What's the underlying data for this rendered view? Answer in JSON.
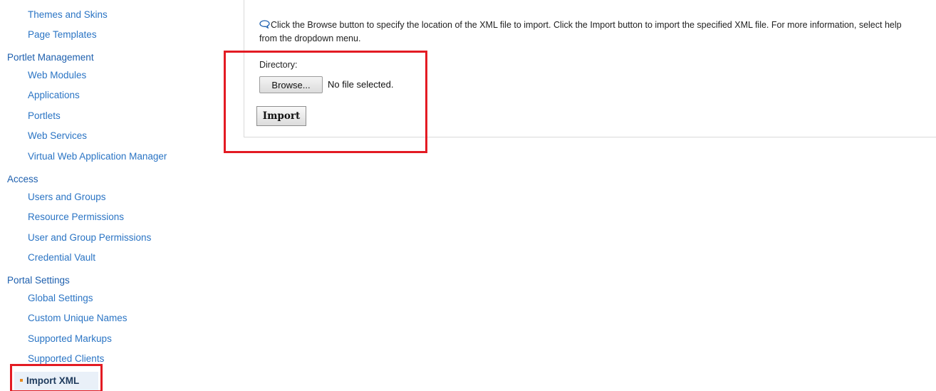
{
  "sidebar": {
    "items": [
      {
        "label": "Themes and Skins",
        "kind": "sub"
      },
      {
        "label": "Page Templates",
        "kind": "sub"
      },
      {
        "label": "Portlet Management",
        "kind": "section"
      },
      {
        "label": "Web Modules",
        "kind": "sub"
      },
      {
        "label": "Applications",
        "kind": "sub"
      },
      {
        "label": "Portlets",
        "kind": "sub"
      },
      {
        "label": "Web Services",
        "kind": "sub"
      },
      {
        "label": "Virtual Web Application Manager",
        "kind": "sub"
      },
      {
        "label": "Access",
        "kind": "section"
      },
      {
        "label": "Users and Groups",
        "kind": "sub"
      },
      {
        "label": "Resource Permissions",
        "kind": "sub"
      },
      {
        "label": "User and Group Permissions",
        "kind": "sub"
      },
      {
        "label": "Credential Vault",
        "kind": "sub"
      },
      {
        "label": "Portal Settings",
        "kind": "section"
      },
      {
        "label": "Global Settings",
        "kind": "sub"
      },
      {
        "label": "Custom Unique Names",
        "kind": "sub"
      },
      {
        "label": "Supported Markups",
        "kind": "sub"
      },
      {
        "label": "Supported Clients",
        "kind": "sub"
      },
      {
        "label": "Import XML",
        "kind": "selected"
      }
    ]
  },
  "main": {
    "help_icon": "speech-bubble-icon",
    "help_text": "Click the Browse button to specify the location of the XML file to import. Click the Import button to import the specified XML file. For more information, select help from the dropdown menu.",
    "directory_label": "Directory:",
    "browse_label": "Browse...",
    "file_status": "No file selected.",
    "import_label": "Import"
  },
  "colors": {
    "link": "#2a74c4",
    "section": "#1d5fae",
    "highlight": "#e31b23",
    "selected_bullet": "#e58a1e"
  }
}
